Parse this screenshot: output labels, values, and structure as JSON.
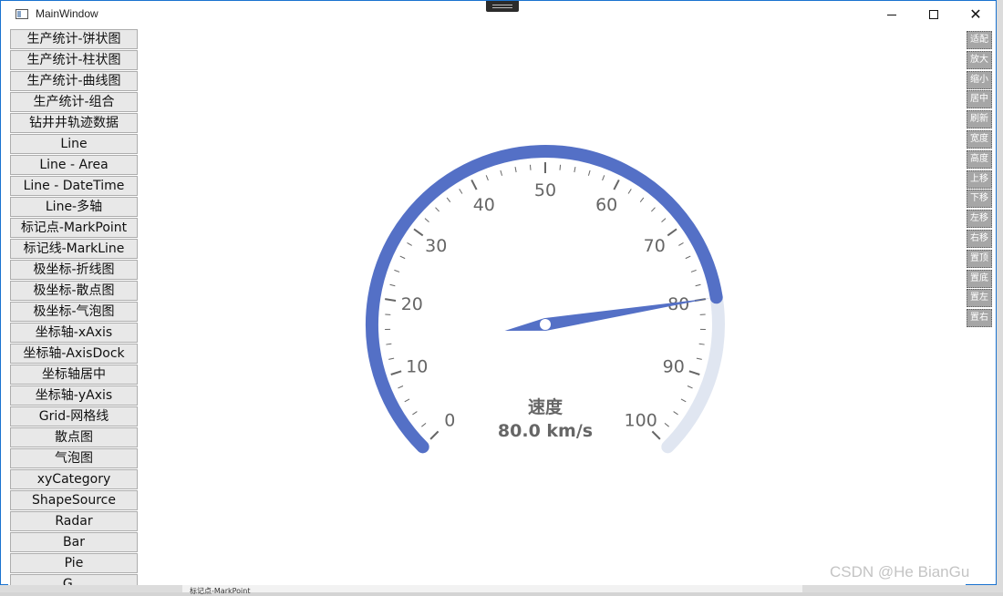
{
  "window": {
    "title": "MainWindow",
    "min_glyph": "minimize",
    "max_glyph": "maximize",
    "close_glyph": "✕"
  },
  "sidebar": {
    "items": [
      "生产统计-饼状图",
      "生产统计-柱状图",
      "生产统计-曲线图",
      "生产统计-组合",
      "钻井井轨迹数据",
      "Line",
      "Line - Area",
      "Line - DateTime",
      "Line-多轴",
      "标记点-MarkPoint",
      "标记线-MarkLine",
      "极坐标-折线图",
      "极坐标-散点图",
      "极坐标-气泡图",
      "坐标轴-xAxis",
      "坐标轴-AxisDock",
      "坐标轴居中",
      "坐标轴-yAxis",
      "Grid-网格线",
      "散点图",
      "气泡图",
      "xyCategory",
      "ShapeSource",
      "Radar",
      "Bar",
      "Pie",
      "G..."
    ]
  },
  "toolbar": {
    "items": [
      "适配",
      "放大",
      "缩小",
      "居中",
      "刷新",
      "宽度",
      "高度",
      "上移",
      "下移",
      "左移",
      "右移",
      "置顶",
      "置底",
      "置左",
      "置右"
    ]
  },
  "gauge": {
    "title": "速度",
    "value": 80.0,
    "unit": "km/s",
    "value_text": "80.0 km/s",
    "min": 0,
    "max": 100,
    "major_ticks": [
      "0",
      "10",
      "20",
      "30",
      "40",
      "50",
      "60",
      "70",
      "80",
      "90",
      "100"
    ],
    "colors": {
      "progress": "#5470c6",
      "track": "#e0e6f1",
      "tick": "#666666",
      "label": "#666666",
      "pointer": "#5470c6"
    }
  },
  "desktop": {
    "strip_label": "标记点-MarkPoint"
  },
  "watermark": "CSDN @He BianGu"
}
